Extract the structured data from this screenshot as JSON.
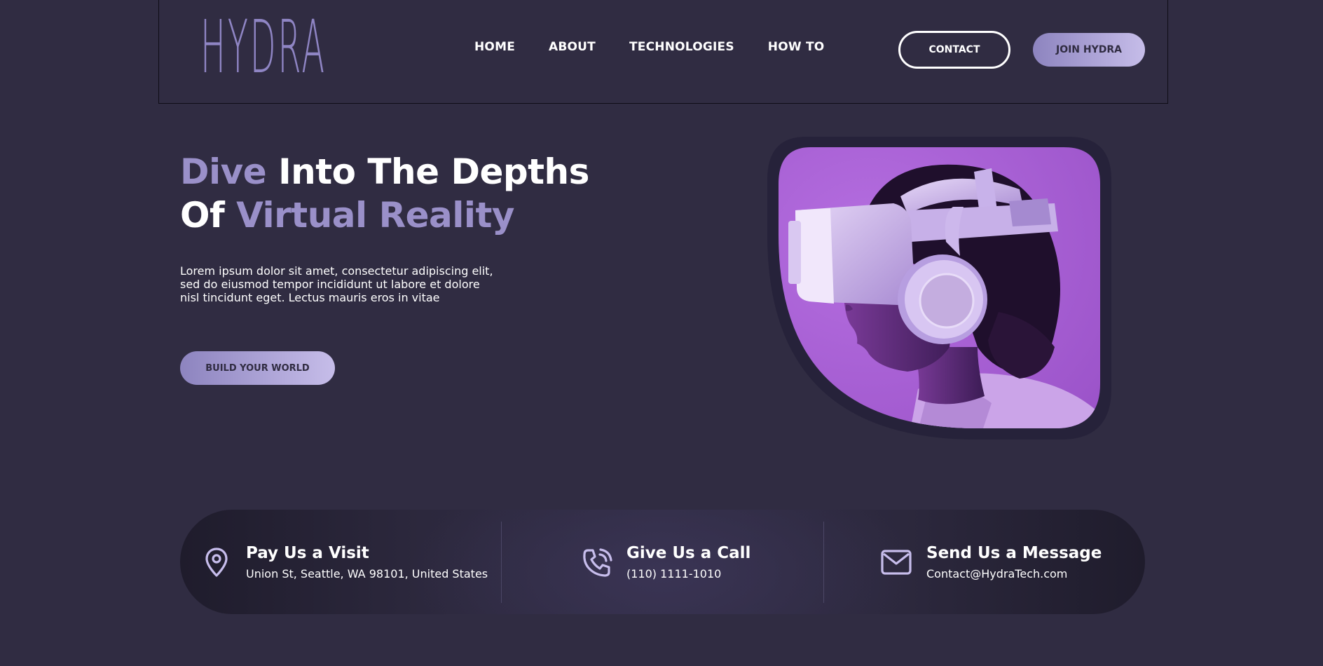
{
  "brand": {
    "name": "HYDRA",
    "color": "#8f85c4"
  },
  "nav": {
    "items": [
      "HOME",
      "ABOUT",
      "TECHNOLOGIES",
      "HOW TO"
    ]
  },
  "header_buttons": {
    "contact": "CONTACT",
    "join": "JOIN HYDRA"
  },
  "hero": {
    "title_line1_accent": "Dive",
    "title_line1_rest": " Into The Depths",
    "title_line2_start": "Of ",
    "title_line2_accent": "Virtual Reality",
    "body_line1": "Lorem ipsum dolor sit amet, consectetur adipiscing elit,",
    "body_line2": "sed do eiusmod tempor incididunt ut labore et dolore",
    "body_line3": "nisl tincidunt eget. Lectus mauris eros in vitae",
    "cta": "BUILD YOUR WORLD",
    "image_icon": "vr-headset-person-image"
  },
  "contact": {
    "visit": {
      "title": "Pay Us a Visit",
      "value": "Union St, Seattle, WA 98101, United States",
      "icon": "location-pin-icon"
    },
    "call": {
      "title": "Give Us a Call",
      "value": "(110) 1111-1010",
      "icon": "phone-icon"
    },
    "message": {
      "title": "Send Us a Message",
      "value": "Contact@HydraTech.com",
      "icon": "mail-icon"
    }
  },
  "colors": {
    "background": "#302c42",
    "accent": "#9a90c9",
    "button_gradient_start": "#8d84bf",
    "button_gradient_end": "#c6bde9",
    "image_purple": "#a05fd0"
  }
}
